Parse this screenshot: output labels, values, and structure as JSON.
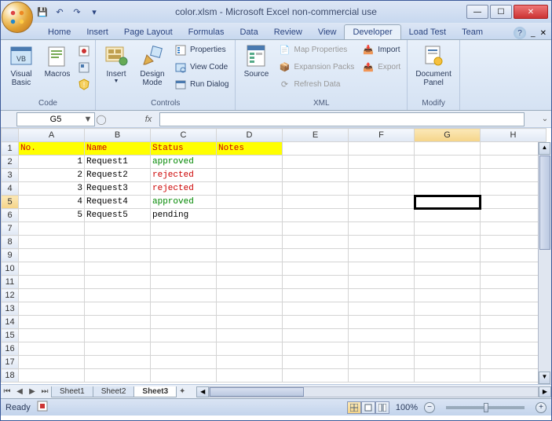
{
  "title": "color.xlsm - Microsoft Excel non-commercial use",
  "qat": {
    "save": "💾",
    "undo": "↶",
    "redo": "↷"
  },
  "tabs": [
    "Home",
    "Insert",
    "Page Layout",
    "Formulas",
    "Data",
    "Review",
    "View",
    "Developer",
    "Load Test",
    "Team"
  ],
  "active_tab": "Developer",
  "ribbon": {
    "code": {
      "label": "Code",
      "visual_basic": "Visual Basic",
      "macros": "Macros"
    },
    "controls": {
      "label": "Controls",
      "insert": "Insert",
      "design_mode": "Design Mode",
      "properties": "Properties",
      "view_code": "View Code",
      "run_dialog": "Run Dialog"
    },
    "xml": {
      "label": "XML",
      "source": "Source",
      "map_properties": "Map Properties",
      "expansion_packs": "Expansion Packs",
      "refresh_data": "Refresh Data",
      "import": "Import",
      "export": "Export"
    },
    "modify": {
      "label": "Modify",
      "document_panel": "Document Panel"
    }
  },
  "name_box": "G5",
  "fx_label": "fx",
  "columns": [
    "A",
    "B",
    "C",
    "D",
    "E",
    "F",
    "G",
    "H"
  ],
  "row_count": 18,
  "headers": {
    "A": "No.",
    "B": "Name",
    "C": "Status",
    "D": "Notes"
  },
  "rows": [
    {
      "no": "1",
      "name": "Request1",
      "status": "approved",
      "status_class": "approved"
    },
    {
      "no": "2",
      "name": "Request2",
      "status": "rejected",
      "status_class": "rejected"
    },
    {
      "no": "3",
      "name": "Request3",
      "status": "rejected",
      "status_class": "rejected"
    },
    {
      "no": "4",
      "name": "Request4",
      "status": "approved",
      "status_class": "approved"
    },
    {
      "no": "5",
      "name": "Request5",
      "status": "pending",
      "status_class": ""
    }
  ],
  "selected_cell": "G5",
  "sheets": [
    "Sheet1",
    "Sheet2",
    "Sheet3"
  ],
  "active_sheet": "Sheet3",
  "status": {
    "ready": "Ready",
    "zoom": "100%"
  }
}
